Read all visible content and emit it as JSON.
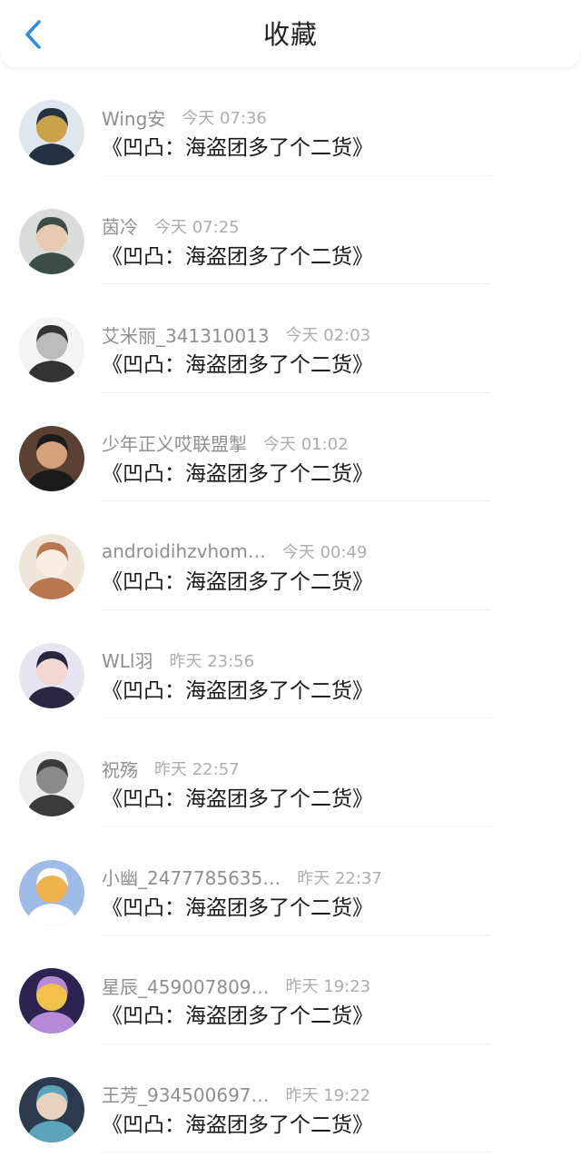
{
  "header": {
    "title": "收藏",
    "back_icon": "chevron-left-icon",
    "accent": "#2a8ee6"
  },
  "items": [
    {
      "name": "Wing安",
      "time": "今天 07:36",
      "content": "《凹凸：海盗团多了个二货》",
      "avatar_colors": [
        "#dfe6ee",
        "#263043",
        "#c9a24a"
      ]
    },
    {
      "name": "茵冷",
      "time": "今天 07:25",
      "content": "《凹凸：海盗团多了个二货》",
      "avatar_colors": [
        "#d9ddd8",
        "#3b4d44",
        "#e8c9b2"
      ]
    },
    {
      "name": "艾米丽_341310013",
      "time": "今天 02:03",
      "content": "《凹凸：海盗团多了个二货》",
      "avatar_colors": [
        "#f4f4f4",
        "#333333",
        "#bbbbbb"
      ]
    },
    {
      "name": "少年正义哎联盟掣",
      "time": "今天 01:02",
      "content": "《凹凸：海盗团多了个二货》",
      "avatar_colors": [
        "#5a4030",
        "#1b1b1b",
        "#d6a27a"
      ]
    },
    {
      "name": "androidihzvhom…",
      "time": "今天 00:49",
      "content": "《凹凸：海盗团多了个二货》",
      "avatar_colors": [
        "#efe5da",
        "#b8774f",
        "#f7efe5"
      ]
    },
    {
      "name": "WLl羽",
      "time": "昨天 23:56",
      "content": "《凹凸：海盗团多了个二货》",
      "avatar_colors": [
        "#e8e4f2",
        "#2a2540",
        "#f2d8d0"
      ]
    },
    {
      "name": "祝殇",
      "time": "昨天 22:57",
      "content": "《凹凸：海盗团多了个二货》",
      "avatar_colors": [
        "#eeeeee",
        "#3b3b3b",
        "#8a8a8a"
      ]
    },
    {
      "name": "小幽_2477785635…",
      "time": "昨天 22:37",
      "content": "《凹凸：海盗团多了个二货》",
      "avatar_colors": [
        "#9fbbe8",
        "#ffffff",
        "#f0b24a"
      ]
    },
    {
      "name": "星辰_459007809…",
      "time": "昨天 19:23",
      "content": "《凹凸：海盗团多了个二货》",
      "avatar_colors": [
        "#2d2350",
        "#b58ad6",
        "#f0c24a"
      ]
    },
    {
      "name": "王芳_934500697…",
      "time": "昨天 19:22",
      "content": "《凹凸：海盗团多了个二货》",
      "avatar_colors": [
        "#2b3a4c",
        "#5aa3b8",
        "#e9d2c0"
      ]
    }
  ]
}
